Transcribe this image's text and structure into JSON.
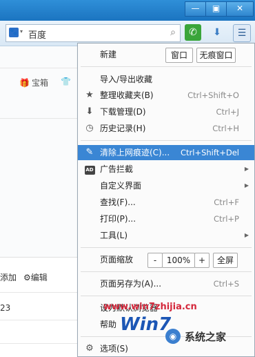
{
  "window": {
    "min": "—",
    "max": "▣",
    "close": "✕"
  },
  "toolbar": {
    "search_text": "百度",
    "engine_icon": "baidu-paw-icon"
  },
  "page": {
    "item1": "宝箱",
    "add": "添加",
    "edit": "编辑",
    "number": "23"
  },
  "menu": {
    "new": "新建",
    "window_btn": "窗口",
    "incognito_btn": "无痕窗口",
    "import_export": "导入/导出收藏",
    "organize": "整理收藏夹(B)",
    "organize_sc": "Ctrl+Shift+O",
    "downloads": "下载管理(D)",
    "downloads_sc": "Ctrl+J",
    "history": "历史记录(H)",
    "history_sc": "Ctrl+H",
    "clear": "清除上网痕迹(C)...",
    "clear_sc": "Ctrl+Shift+Del",
    "adblock": "广告拦截",
    "customize": "自定义界面",
    "find": "查找(F)...",
    "find_sc": "Ctrl+F",
    "print": "打印(P)...",
    "print_sc": "Ctrl+P",
    "tools": "工具(L)",
    "zoom": "页面缩放",
    "zoom_minus": "-",
    "zoom_value": "100%",
    "zoom_plus": "+",
    "fullscreen": "全屏",
    "save_as": "页面另存为(A)...",
    "save_as_sc": "Ctrl+S",
    "set_default": "设为默认浏览器",
    "help": "帮助",
    "options": "选项(S)"
  },
  "watermark": {
    "url": "www.win7zhijia.cn",
    "logo": "Win7",
    "site": "系统之家"
  }
}
